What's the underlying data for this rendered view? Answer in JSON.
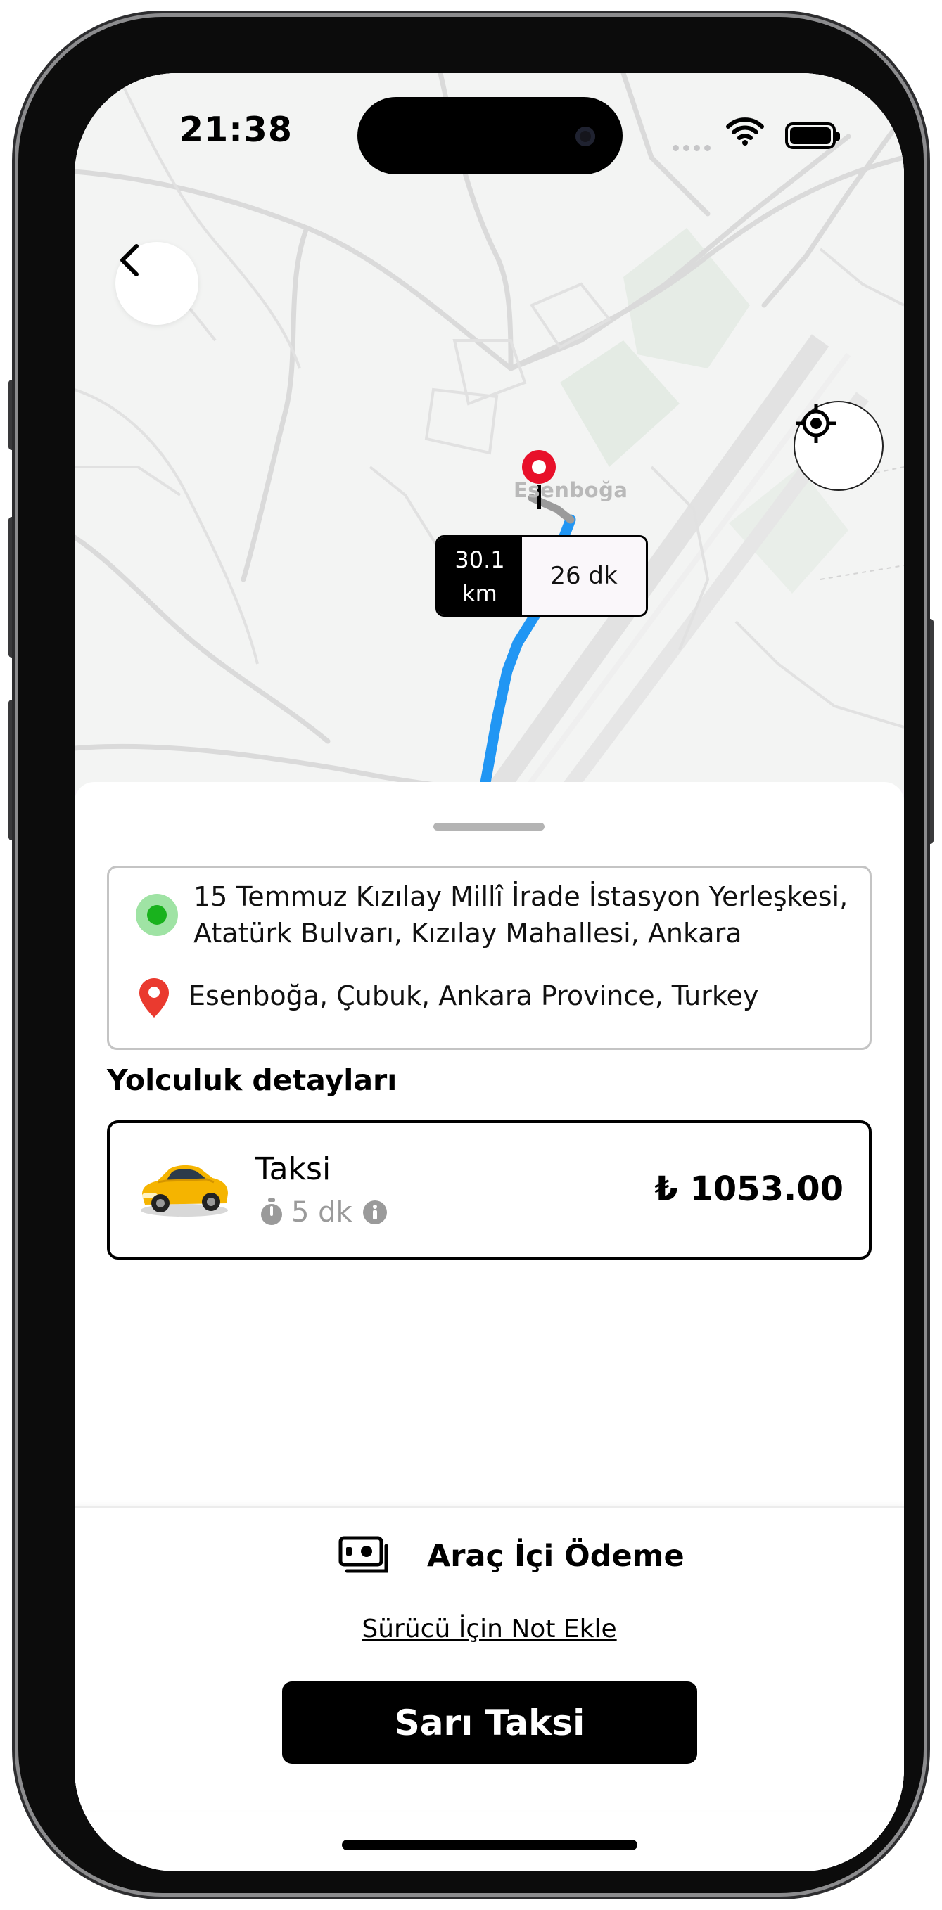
{
  "status_bar": {
    "time": "21:38"
  },
  "map": {
    "city_label": "Esenboğa",
    "distance_value": "30.1",
    "distance_unit": "km",
    "duration": "26 dk",
    "route_color": "#2196f3",
    "pin_color": "#e8102a"
  },
  "trip": {
    "origin": "15 Temmuz Kızılay Millî İrade İstasyon Yerleşkesi, Atatürk Bulvarı, Kızılay Mahallesi, Ankara",
    "destination": "Esenboğa, Çubuk, Ankara Province, Turkey",
    "origin_color": "#19b21d",
    "destination_color": "#ea3a2f"
  },
  "details": {
    "title": "Yolculuk detayları",
    "ride": {
      "name": "Taksi",
      "eta": "5 dk",
      "price": "₺ 1053.00"
    }
  },
  "footer": {
    "payment_label": "Araç İçi Ödeme",
    "note_link": "Sürücü İçin Not Ekle",
    "cta_label": "Sarı Taksi"
  },
  "icons": [
    "back-chevron-icon",
    "locate-icon",
    "map-pin-icon",
    "taxi-car-icon",
    "stopwatch-icon",
    "info-icon",
    "cash-icon",
    "wifi-icon",
    "battery-icon"
  ]
}
